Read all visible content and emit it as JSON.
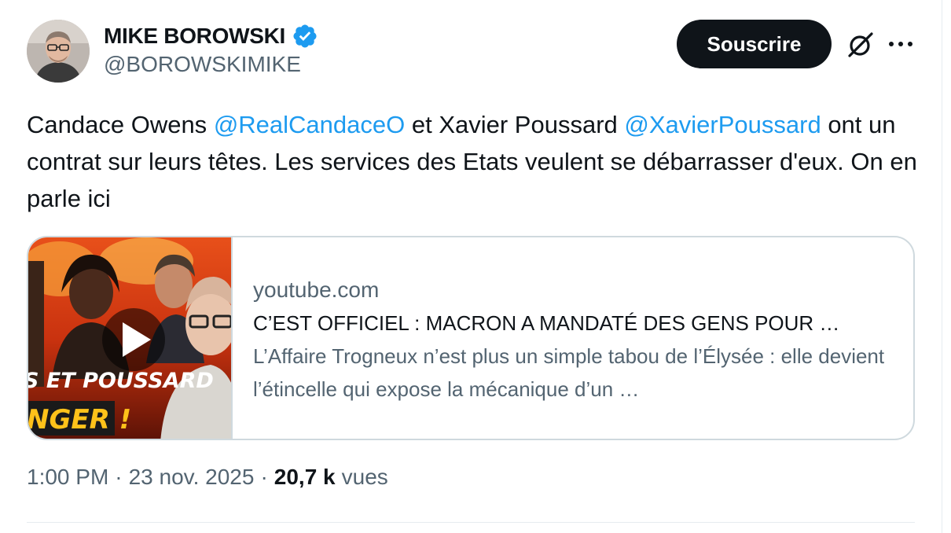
{
  "author": {
    "display_name": "MIKE BOROWSKI",
    "handle": "@BOROWSKIMIKE",
    "verified_icon": "verified-badge-icon"
  },
  "actions": {
    "subscribe_label": "Souscrire",
    "grok_icon": "grok-icon",
    "more_icon": "more-horizontal-icon"
  },
  "tweet": {
    "text_1": "Candace Owens ",
    "mention_1": "@RealCandaceO",
    "text_2": " et Xavier Poussard ",
    "mention_2": "@XavierPoussard",
    "text_3": " ont un contrat sur leurs têtes. Les services des Etats veulent se débarrasser d'eux. On en parle ici"
  },
  "card": {
    "domain": "youtube.com",
    "title": "C’EST OFFICIEL : MACRON A MANDATÉ DES GENS POUR …",
    "description": "L’Affaire Trogneux n’est plus un simple tabou de l’Élysée : elle devient l’étincelle qui expose la mécanique d’un …",
    "thumbnail_text_1": "S ET POUSSARD",
    "thumbnail_text_2": "NGER !",
    "play_icon": "play-icon"
  },
  "meta": {
    "time": "1:00 PM",
    "date": "23 nov. 2025",
    "views_count": "20,7 k",
    "views_label": "vues",
    "separator": "·"
  },
  "colors": {
    "accent": "#1d9bf0",
    "text": "#0f1419",
    "secondary": "#536471",
    "border": "#cfd9de"
  }
}
